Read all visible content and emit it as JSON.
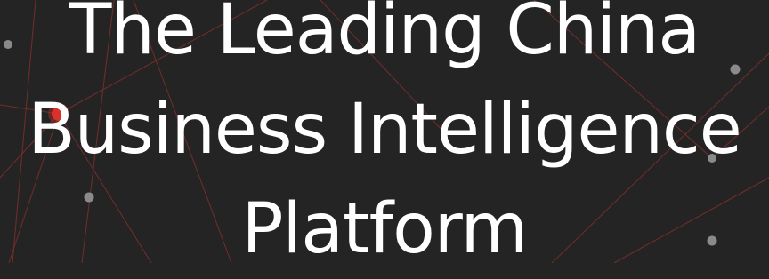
{
  "hero": {
    "headline_lines": [
      "The Leading China",
      "Business Intelligence",
      "Platform"
    ]
  },
  "colors": {
    "background": "#252424",
    "text": "#ffffff",
    "accent_node": "#d9312b",
    "line": "#a13a36",
    "node": "#8a8a8a"
  },
  "icons": [
    "network-node-icon"
  ]
}
